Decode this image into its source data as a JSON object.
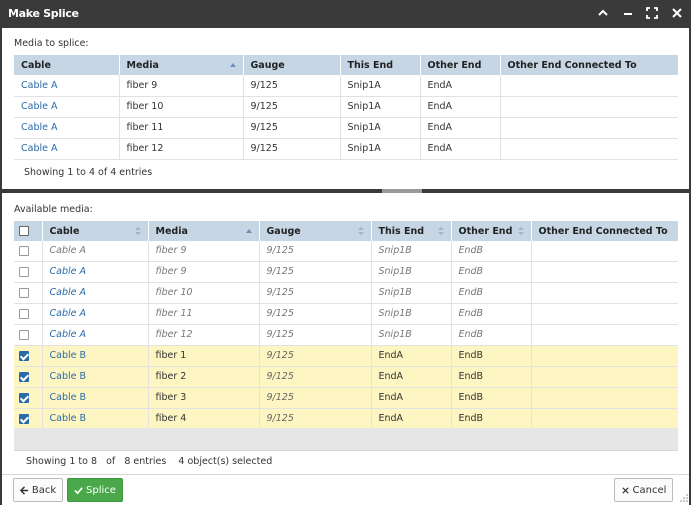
{
  "window": {
    "title": "Make Splice"
  },
  "media_section": {
    "label": "Media to splice:",
    "columns": [
      "Cable",
      "Media",
      "Gauge",
      "This End",
      "Other End",
      "Other End Connected To"
    ],
    "rows": [
      {
        "cable": "Cable A",
        "media": "fiber 9",
        "gauge": "9/125",
        "this_end": "Snip1A",
        "other_end": "EndA",
        "connected_to": ""
      },
      {
        "cable": "Cable A",
        "media": "fiber 10",
        "gauge": "9/125",
        "this_end": "Snip1A",
        "other_end": "EndA",
        "connected_to": ""
      },
      {
        "cable": "Cable A",
        "media": "fiber 11",
        "gauge": "9/125",
        "this_end": "Snip1A",
        "other_end": "EndA",
        "connected_to": ""
      },
      {
        "cable": "Cable A",
        "media": "fiber 12",
        "gauge": "9/125",
        "this_end": "Snip1A",
        "other_end": "EndA",
        "connected_to": ""
      }
    ],
    "status": "Showing 1 to 4 of 4 entries"
  },
  "available_section": {
    "label": "Available media:",
    "columns": [
      "Cable",
      "Media",
      "Gauge",
      "This End",
      "Other End",
      "Other End Connected To"
    ],
    "filter_row": {
      "cable": "Cable A",
      "media": "fiber 9",
      "gauge": "9/125",
      "this_end": "Snip1B",
      "other_end": "EndB",
      "connected_to": ""
    },
    "rows": [
      {
        "checked": false,
        "cable": "Cable A",
        "media": "fiber 9",
        "gauge": "9/125",
        "this_end": "Snip1B",
        "other_end": "EndB",
        "connected_to": ""
      },
      {
        "checked": false,
        "cable": "Cable A",
        "media": "fiber 10",
        "gauge": "9/125",
        "this_end": "Snip1B",
        "other_end": "EndB",
        "connected_to": ""
      },
      {
        "checked": false,
        "cable": "Cable A",
        "media": "fiber 11",
        "gauge": "9/125",
        "this_end": "Snip1B",
        "other_end": "EndB",
        "connected_to": ""
      },
      {
        "checked": false,
        "cable": "Cable A",
        "media": "fiber 12",
        "gauge": "9/125",
        "this_end": "Snip1B",
        "other_end": "EndB",
        "connected_to": ""
      },
      {
        "checked": true,
        "cable": "Cable B",
        "media": "fiber 1",
        "gauge": "9/125",
        "this_end": "EndA",
        "other_end": "EndB",
        "connected_to": ""
      },
      {
        "checked": true,
        "cable": "Cable B",
        "media": "fiber 2",
        "gauge": "9/125",
        "this_end": "EndA",
        "other_end": "EndB",
        "connected_to": ""
      },
      {
        "checked": true,
        "cable": "Cable B",
        "media": "fiber 3",
        "gauge": "9/125",
        "this_end": "EndA",
        "other_end": "EndB",
        "connected_to": ""
      },
      {
        "checked": true,
        "cable": "Cable B",
        "media": "fiber 4",
        "gauge": "9/125",
        "this_end": "EndA",
        "other_end": "EndB",
        "connected_to": ""
      }
    ],
    "status": {
      "showing": "Showing 1 to 8",
      "of": "of",
      "entries": "8 entries",
      "selected": "4 object(s) selected"
    }
  },
  "footer": {
    "back_label": "Back",
    "splice_label": "Splice",
    "cancel_label": "Cancel"
  },
  "colors": {
    "titlebar": "#3a3a3a",
    "header": "#c6d6e5",
    "link": "#2a6aa8",
    "selected_row": "#fdf5c2",
    "splice_button": "#4aa84a"
  }
}
